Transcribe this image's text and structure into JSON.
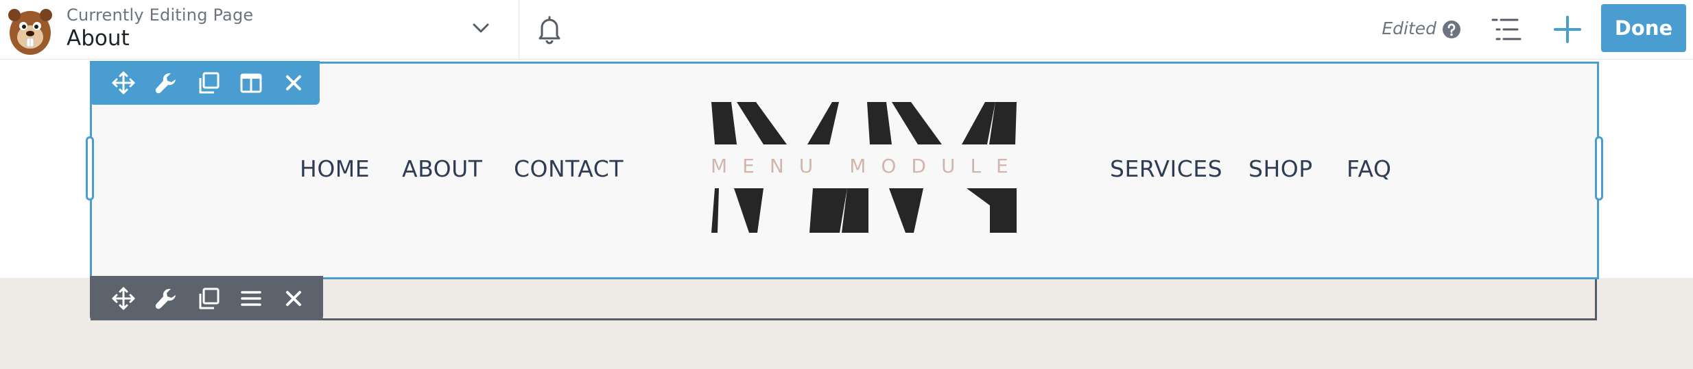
{
  "header": {
    "editing_label": "Currently Editing Page",
    "page_name": "About",
    "status": "Edited",
    "done_label": "Done",
    "icons": [
      "beaver-logo-icon",
      "chevron-down-icon",
      "bell-icon",
      "help-icon",
      "outline-list-icon",
      "plus-icon"
    ]
  },
  "module": {
    "nav_left": [
      "HOME",
      "ABOUT",
      "CONTACT"
    ],
    "nav_right": [
      "SERVICES",
      "SHOP",
      "FAQ"
    ],
    "logo_text": "MENU MODULE"
  },
  "toolbars": {
    "module_actions": [
      "move-icon",
      "wrench-icon",
      "duplicate-icon",
      "columns-icon",
      "close-icon"
    ],
    "row_actions": [
      "move-icon",
      "wrench-icon",
      "duplicate-icon",
      "menu-icon",
      "close-icon"
    ]
  },
  "colors": {
    "accent": "#4a9dd0",
    "row_toolbar": "#5c636d",
    "nav_text": "#2f3c55",
    "logo_dark": "#262626",
    "logo_text": "#d2b5ad",
    "beige_background": "#eeeae5"
  }
}
